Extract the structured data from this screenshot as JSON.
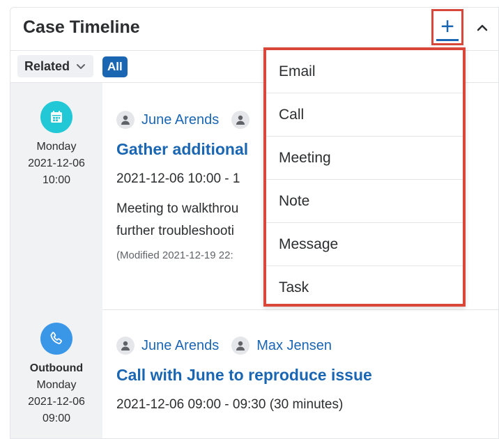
{
  "header": {
    "title": "Case Timeline",
    "add_symbol": "+",
    "collapse_icon": "chevron-up-icon"
  },
  "filters": {
    "related_label": "Related",
    "all_label": "All"
  },
  "entries": [
    {
      "icon": "calendar-icon",
      "icon_color": "#22c8d6",
      "date_lines": [
        "Monday",
        "2021-12-06",
        "10:00"
      ],
      "people": [
        "June Arends",
        ""
      ],
      "title": "Gather additional",
      "time": "2021-12-06 10:00 - 1",
      "description": [
        "Meeting to walkthrou",
        "further troubleshooti"
      ],
      "modified": "(Modified 2021-12-19 22:"
    },
    {
      "icon": "phone-icon",
      "icon_color": "#3a97e8",
      "direction": "Outbound",
      "date_lines": [
        "Monday",
        "2021-12-06",
        "09:00"
      ],
      "people": [
        "June Arends",
        "Max Jensen"
      ],
      "title": "Call with June to reproduce issue",
      "time": "2021-12-06 09:00 - 09:30 (30 minutes)"
    }
  ],
  "menu": {
    "items": [
      "Email",
      "Call",
      "Meeting",
      "Note",
      "Message",
      "Task"
    ]
  },
  "colors": {
    "accent": "#1a66b3",
    "highlight": "#d9473a",
    "rail": "#f1f2f4"
  }
}
